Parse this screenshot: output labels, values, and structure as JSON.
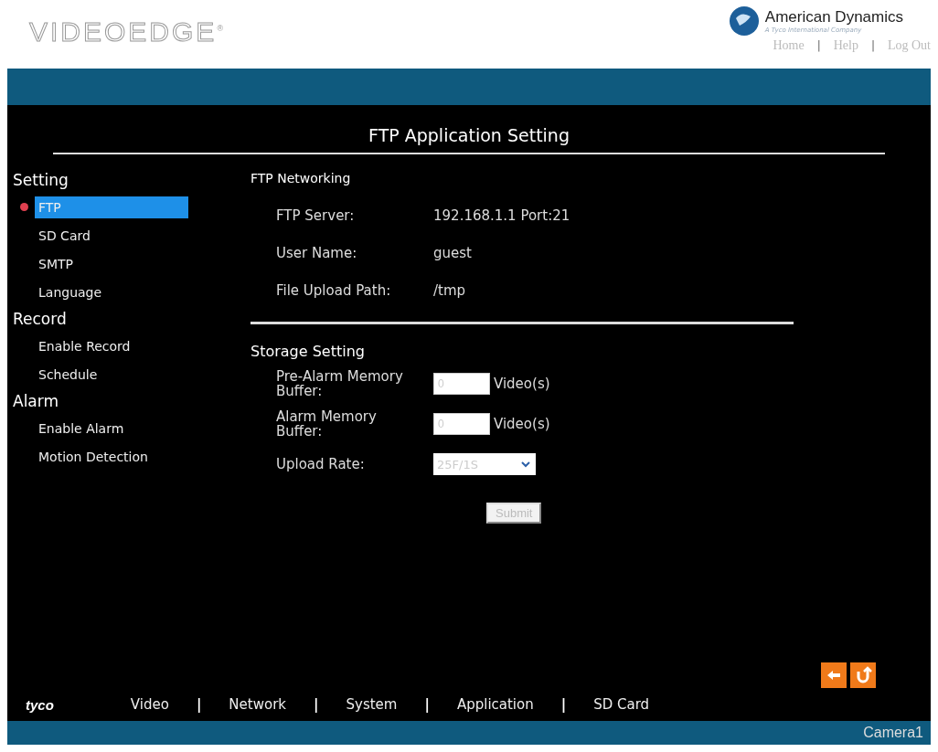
{
  "header": {
    "logo": "VIDEOEDGE",
    "logo_mark": "®",
    "brand": "American Dynamics",
    "brand_tagline": "A Tyco International Company",
    "links": [
      {
        "kind": "link",
        "label": "Home"
      },
      {
        "kind": "separator",
        "label": "|"
      },
      {
        "kind": "link",
        "label": "Help"
      },
      {
        "kind": "separator",
        "label": "|"
      },
      {
        "kind": "link",
        "label": "Log Out"
      }
    ]
  },
  "page_title": "FTP Application Setting",
  "sidebar": {
    "groups": [
      {
        "label": "Setting",
        "children": [
          {
            "label": "FTP",
            "selected": true
          },
          {
            "label": "SD Card",
            "selected": false
          },
          {
            "label": "SMTP",
            "selected": false
          },
          {
            "label": "Language",
            "selected": false
          }
        ]
      },
      {
        "label": "Record",
        "children": [
          {
            "label": "Enable Record",
            "selected": false
          },
          {
            "label": "Schedule",
            "selected": false
          }
        ]
      },
      {
        "label": "Alarm",
        "children": [
          {
            "label": "Enable Alarm",
            "selected": false
          },
          {
            "label": "Motion Detection",
            "selected": false
          }
        ]
      }
    ]
  },
  "ftp_networking": {
    "title": "FTP Networking",
    "rows": [
      {
        "label": "FTP Server:",
        "value": "192.168.1.1  Port:21"
      },
      {
        "label": "User Name:",
        "value": "guest"
      },
      {
        "label": "File Upload Path:",
        "value": "/tmp"
      }
    ]
  },
  "storage_setting": {
    "title": "Storage Setting",
    "rows": [
      {
        "kind": "input",
        "label": "Pre-Alarm Memory Buffer:",
        "value": "0",
        "unit": "Video(s)"
      },
      {
        "kind": "input",
        "label": "Alarm Memory Buffer:",
        "value": "0",
        "unit": "Video(s)"
      },
      {
        "kind": "select",
        "label": "Upload Rate:",
        "value": "25F/1S"
      }
    ],
    "submit": "Submit"
  },
  "footer": {
    "logo": "tyco",
    "nav": [
      {
        "kind": "link",
        "label": "Video"
      },
      {
        "kind": "separator",
        "label": "|"
      },
      {
        "kind": "link",
        "label": "Network"
      },
      {
        "kind": "separator",
        "label": "|"
      },
      {
        "kind": "link",
        "label": "System"
      },
      {
        "kind": "separator",
        "label": "|"
      },
      {
        "kind": "link",
        "label": "Application"
      },
      {
        "kind": "separator",
        "label": "|"
      },
      {
        "kind": "link",
        "label": "SD Card"
      }
    ],
    "status": "Camera1"
  }
}
